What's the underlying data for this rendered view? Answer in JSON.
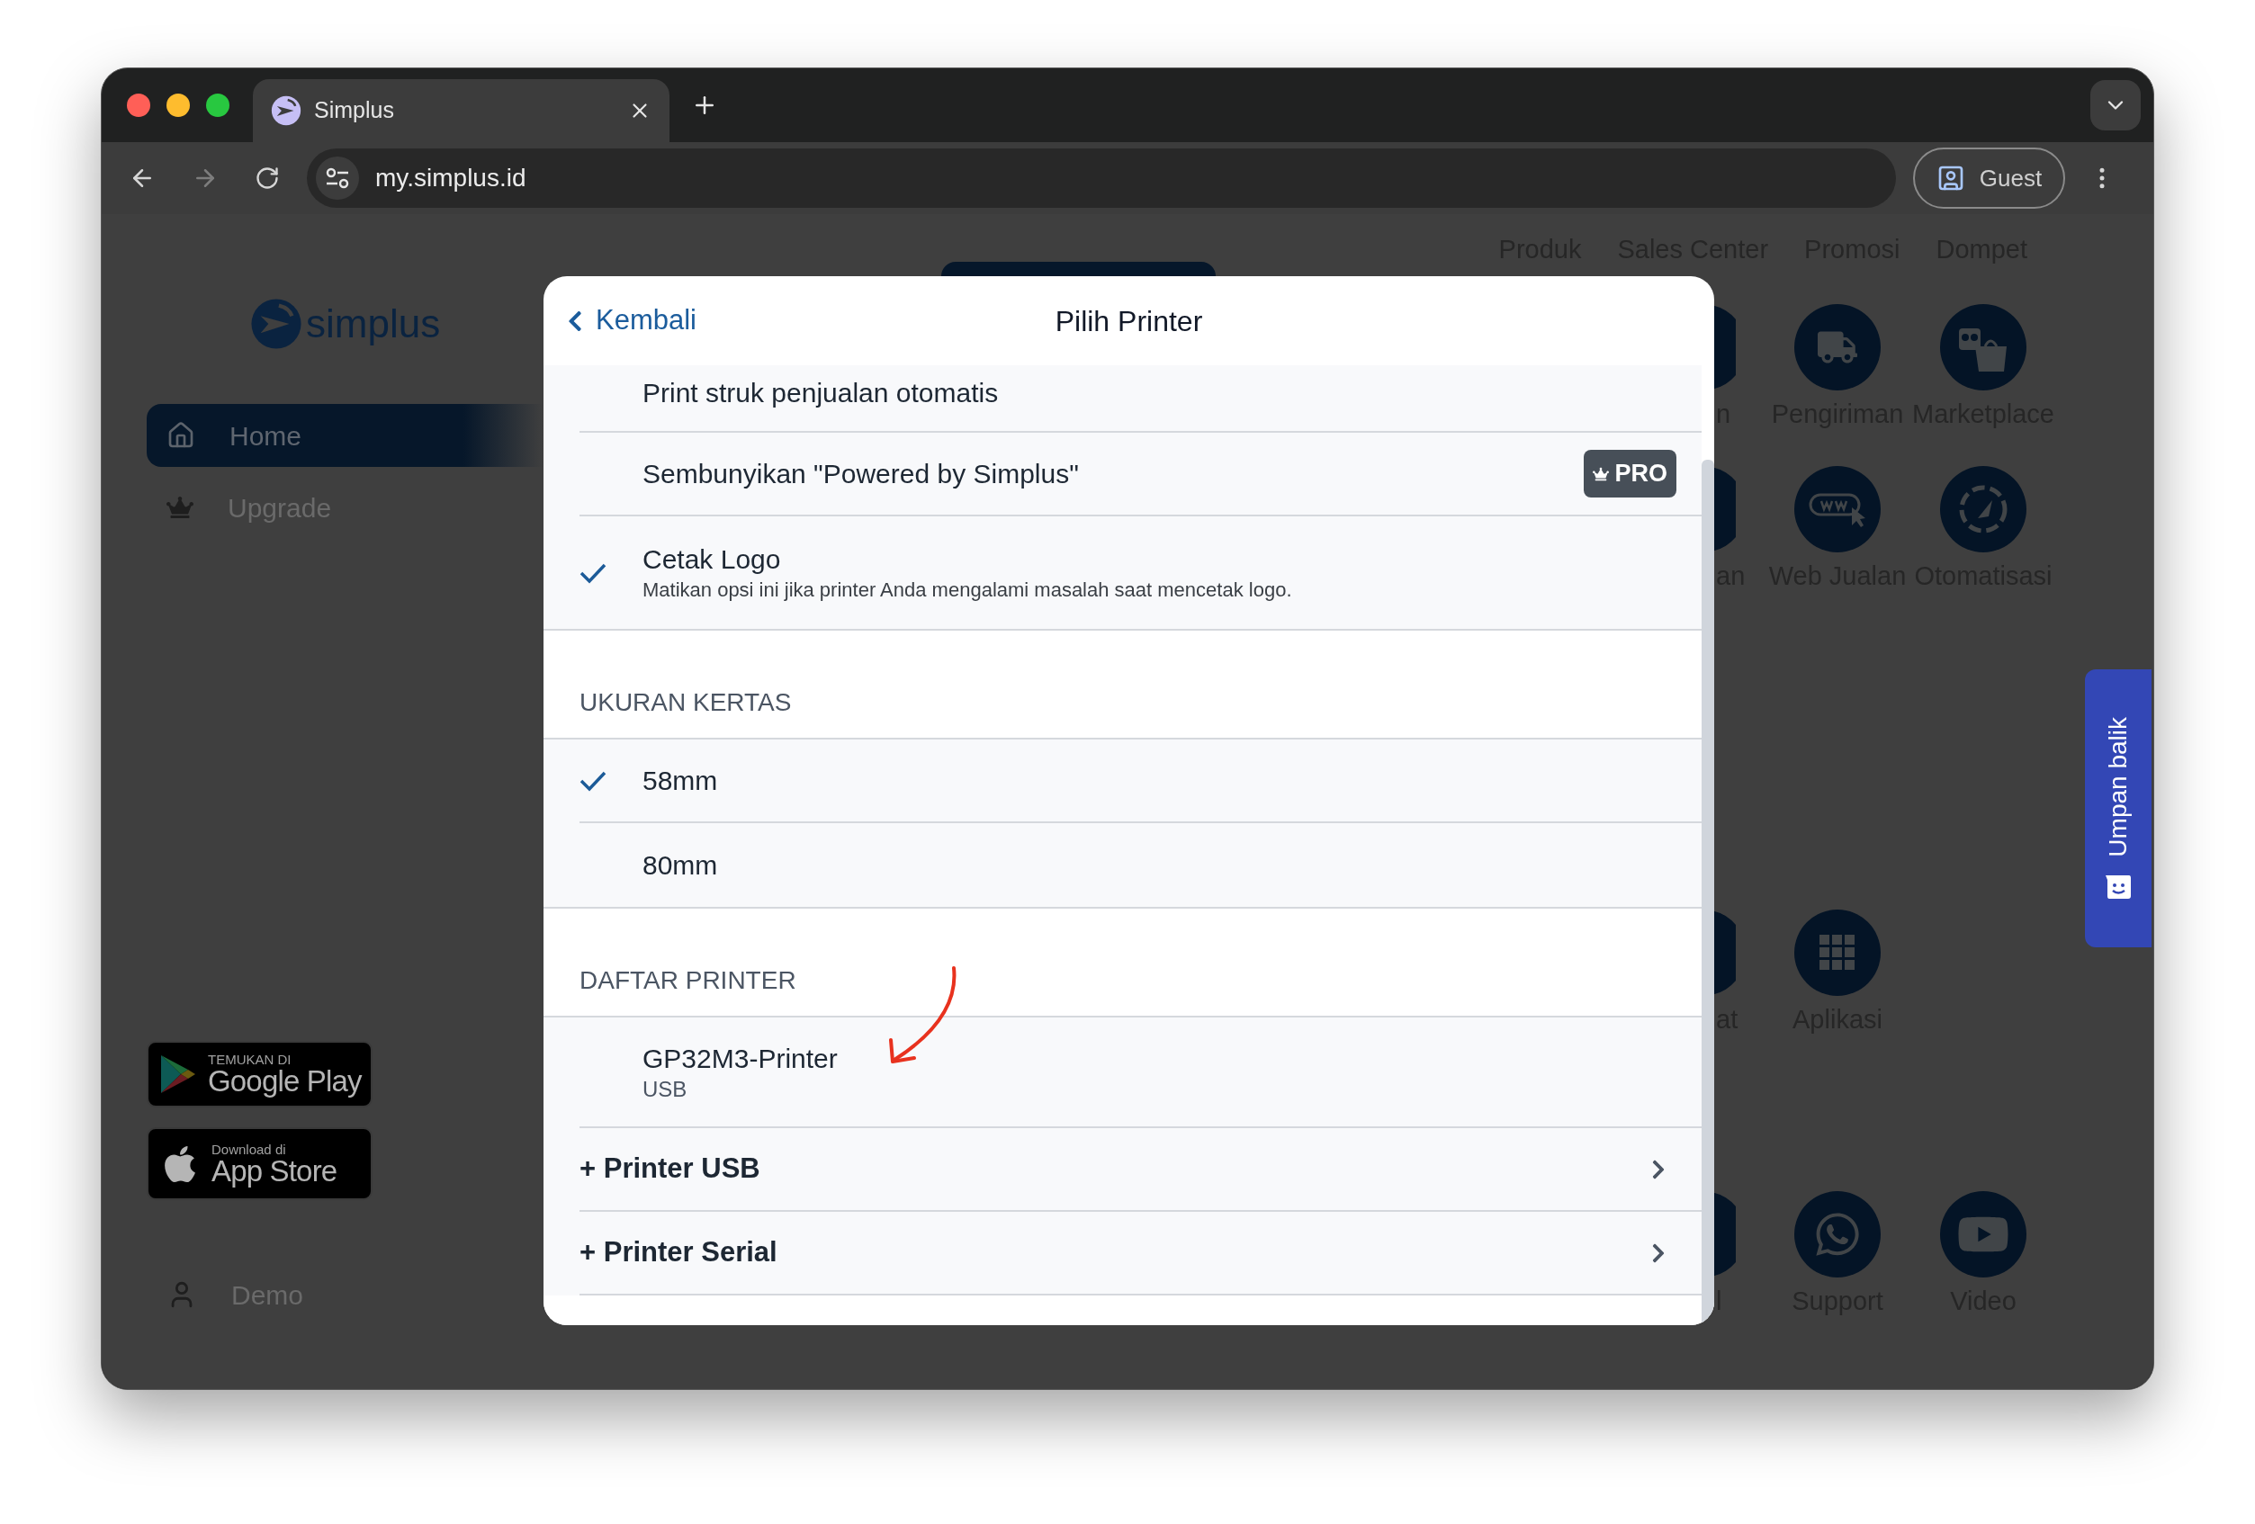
{
  "browser": {
    "tab_title": "Simplus",
    "url": "my.simplus.id",
    "profile": "Guest"
  },
  "sidebar": {
    "logo": "simplus",
    "items": [
      {
        "label": "Home",
        "selected": true
      },
      {
        "label": "Upgrade",
        "selected": false
      }
    ],
    "store_badges": [
      {
        "kind": "google_play",
        "caption": "TEMUKAN DI",
        "store": "Google Play"
      },
      {
        "kind": "app_store",
        "caption": "Download di",
        "store": "App Store"
      }
    ],
    "user": "Demo"
  },
  "top_nav": [
    "Produk",
    "Sales Center",
    "Promosi",
    "Dompet"
  ],
  "shortcuts": [
    {
      "cut_label": "n",
      "tiles": [
        "Pengiriman",
        "Marketplace"
      ]
    },
    {
      "cut_label": "an",
      "tiles": [
        "Web Jualan",
        "Otomatisasi"
      ]
    },
    {
      "cut_label": "at",
      "tiles": [
        "Aplikasi"
      ]
    },
    {
      "cut_label": "l",
      "tiles": [
        "Support",
        "Video"
      ]
    }
  ],
  "feedback": {
    "label": "Umpan balik"
  },
  "modal": {
    "back": "Kembali",
    "title": "Pilih Printer",
    "sections": [
      {
        "rows": [
          {
            "kind": "option",
            "label": "Print struk penjualan otomatis",
            "checked": false
          },
          {
            "kind": "option",
            "label": "Sembunyikan \"Powered by Simplus\"",
            "checked": false,
            "badge": "PRO"
          },
          {
            "kind": "option",
            "label": "Cetak Logo",
            "checked": true,
            "description": "Matikan opsi ini jika printer Anda mengalami masalah saat mencetak logo."
          }
        ]
      },
      {
        "header": "UKURAN KERTAS",
        "rows": [
          {
            "kind": "option",
            "label": "58mm",
            "checked": true
          },
          {
            "kind": "option",
            "label": "80mm",
            "checked": false
          }
        ]
      },
      {
        "header": "DAFTAR PRINTER",
        "rows": [
          {
            "kind": "device",
            "label": "GP32M3-Printer",
            "description": "USB"
          },
          {
            "kind": "action",
            "label": "+ Printer USB"
          },
          {
            "kind": "action",
            "label": "+ Printer Serial"
          }
        ]
      }
    ]
  }
}
